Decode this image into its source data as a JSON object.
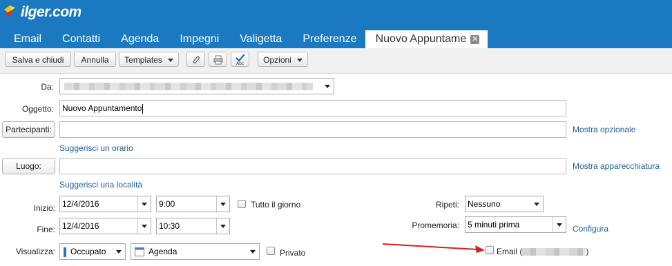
{
  "brand": {
    "logo_text": "ilger.com"
  },
  "tabs": [
    {
      "label": "Email"
    },
    {
      "label": "Contatti"
    },
    {
      "label": "Agenda"
    },
    {
      "label": "Impegni"
    },
    {
      "label": "Valigetta"
    },
    {
      "label": "Preferenze"
    },
    {
      "label": "Nuovo Appuntame",
      "active": true,
      "close_icon": "close-icon"
    }
  ],
  "toolbar": {
    "save_close": "Salva e chiudi",
    "cancel": "Annulla",
    "templates": "Templates",
    "options": "Opzioni",
    "icons": [
      "paperclip-icon",
      "printer-icon",
      "spellcheck-icon"
    ]
  },
  "form": {
    "from_label": "Da:",
    "subject_label": "Oggetto:",
    "subject_value": "Nuovo Appuntamento",
    "attendees_button": "Partecipanti:",
    "attendees_value": "",
    "show_optional": "Mostra opzionale",
    "suggest_time": "Suggerisci un orario",
    "location_button": "Luogo:",
    "location_value": "",
    "show_equipment": "Mostra apparecchiatura",
    "suggest_location": "Suggerisci una località",
    "start_label": "Inizio:",
    "start_date": "12/4/2016",
    "start_time": "9:00",
    "all_day": "Tutto il giorno",
    "end_label": "Fine:",
    "end_date": "12/4/2016",
    "end_time": "10:30",
    "repeat_label": "Ripeti:",
    "repeat_value": "Nessuno",
    "reminder_label": "Promemoria:",
    "reminder_value": "5 minuti prima",
    "configure": "Configura",
    "show_as_label": "Visualizza:",
    "show_as_value": "Occupato",
    "calendar_value": "Agenda",
    "private_label": "Privato",
    "email_prefix": "Email (",
    "email_suffix": ")"
  },
  "colors": {
    "header": "#1a79c0",
    "link": "#1d5e98",
    "busy_indicator": "#2a6fc0",
    "arrow": "#e01b1b"
  }
}
